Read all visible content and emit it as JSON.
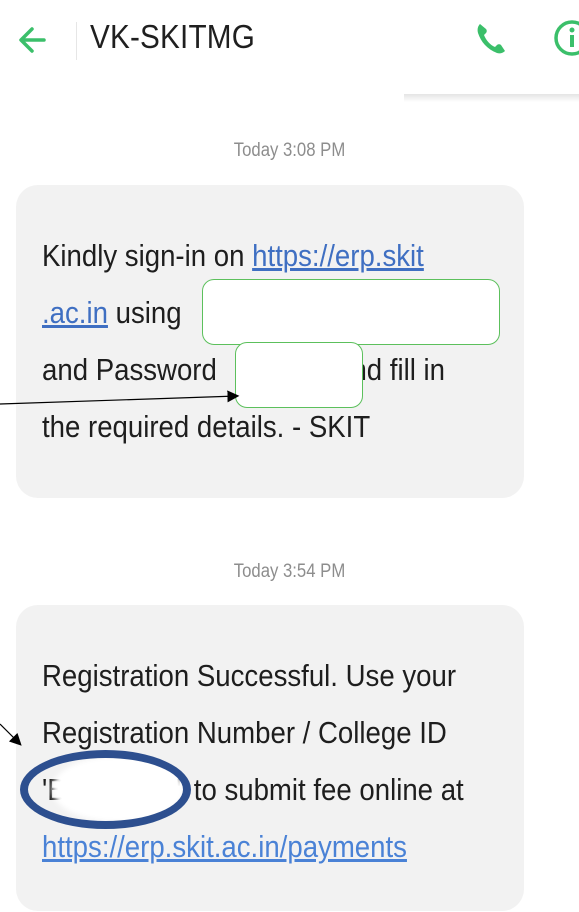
{
  "header": {
    "back_icon": "arrow-left-icon",
    "contact": "VK-SKITMG",
    "call_icon": "phone-icon",
    "info_icon": "info-icon",
    "accent": "#3bbf6a"
  },
  "messages": [
    {
      "time": "Today 3:08 PM",
      "line1_pre": "Kindly sign-in on ",
      "line1_link": "https://erp.skit",
      "line2_link": ".ac.in",
      "line2_post": " using",
      "line3_pre": "and Password",
      "line3_post": "and fill in",
      "line4": "the required details. - SKIT"
    },
    {
      "time": "Today 3:54 PM",
      "line1": "Registration Successful. Use your",
      "line2": "Registration Number / College ID",
      "line3_pre": "'B",
      "line3_mid": "'",
      "line3_post": "to submit fee online at",
      "line4_link": "https://erp.skit.ac.in/payments"
    }
  ],
  "colors": {
    "bubble": "#f2f2f2",
    "link": "#3f6fc2",
    "redaction_border": "#5cc05c",
    "circle_annotation": "#2d4f8f"
  }
}
